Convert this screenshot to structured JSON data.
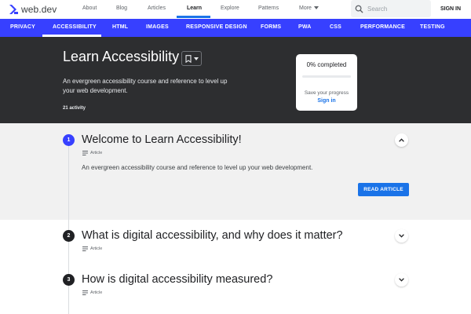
{
  "topnav": {
    "logo_text": "web.dev",
    "links": [
      "About",
      "Blog",
      "Articles",
      "Learn",
      "Explore",
      "Patterns",
      "More"
    ],
    "active": "Learn",
    "search_placeholder": "Search",
    "signin": "SIGN IN"
  },
  "categories": [
    "PRIVACY",
    "ACCESSIBILITY",
    "HTML",
    "IMAGES",
    "RESPONSIVE DESIGN",
    "FORMS",
    "PWA",
    "CSS",
    "PERFORMANCE",
    "TESTING"
  ],
  "active_category": "ACCESSIBILITY",
  "hero": {
    "title": "Learn Accessibility",
    "description": "An evergreen accessibility course and reference to level up your web development.",
    "count": "21 activity"
  },
  "progress": {
    "label": "0% completed",
    "percent": 0,
    "save_text": "Save your progress",
    "signin": "Sign in"
  },
  "modules": [
    {
      "number": "1",
      "title": "Welcome to Learn Accessibility!",
      "type": "Article",
      "description": "An evergreen accessibility course and reference to level up your web development.",
      "button": "READ ARTICLE",
      "expanded": true
    },
    {
      "number": "2",
      "title": "What is digital accessibility, and why does it matter?",
      "type": "Article",
      "expanded": false
    },
    {
      "number": "3",
      "title": "How is digital accessibility measured?",
      "type": "Article",
      "expanded": false
    }
  ],
  "colors": {
    "brand_blue": "#3740ff",
    "link_blue": "#1a73e8",
    "hero_bg": "#2d2e30"
  }
}
